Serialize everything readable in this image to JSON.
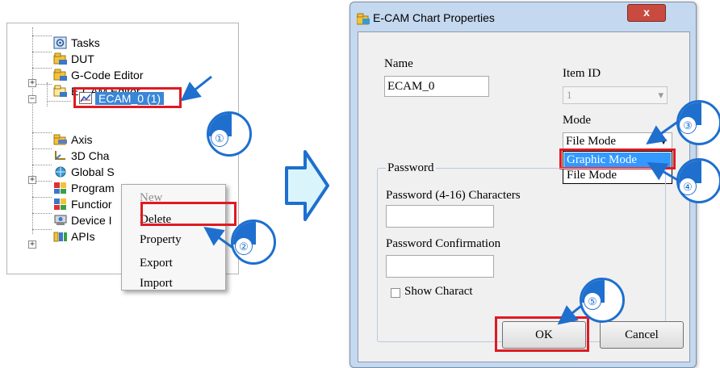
{
  "tree": {
    "items": [
      {
        "label": "Tasks",
        "icon": "tasks-icon"
      },
      {
        "label": "DUT",
        "icon": "dut-icon"
      },
      {
        "label": "G-Code Editor",
        "icon": "gcode-editor-icon"
      },
      {
        "label": "E-CAM Editor",
        "icon": "ecam-editor-icon"
      },
      {
        "label": "ECAM_0 (1)",
        "icon": "ecam-chart-icon",
        "selected": true
      },
      {
        "label": "Axis",
        "icon": "axis-icon"
      },
      {
        "label": "3D Cha",
        "icon": "3d-chart-icon"
      },
      {
        "label": "Global S",
        "icon": "global-variables-icon"
      },
      {
        "label": "Program",
        "icon": "program-icon"
      },
      {
        "label": "Functior",
        "icon": "function-icon"
      },
      {
        "label": "Device I",
        "icon": "device-icon"
      },
      {
        "label": "APIs",
        "icon": "apis-icon"
      }
    ]
  },
  "context_menu": {
    "items": [
      {
        "label": "New",
        "disabled": true
      },
      {
        "label": "Delete"
      },
      {
        "label": "Property"
      },
      {
        "label": "Export"
      },
      {
        "label": "Import"
      }
    ]
  },
  "steps": [
    "①",
    "②",
    "③",
    "④",
    "⑤"
  ],
  "dialog": {
    "title": "E-CAM Chart Properties",
    "close_label": "x",
    "name_label": "Name",
    "name_value": "ECAM_0",
    "item_id_label": "Item ID",
    "item_id_value": "1",
    "mode_label": "Mode",
    "mode_value": "File Mode",
    "mode_options": [
      "Graphic Mode",
      "File Mode"
    ],
    "password_group": "Password",
    "password_label": "Password (4-16) Characters",
    "password_value": "",
    "confirm_label": "Password Confirmation",
    "confirm_value": "",
    "show_chars_label": "Show Charact",
    "ok_label": "OK",
    "cancel_label": "Cancel"
  },
  "colors": {
    "highlight_red": "#e01a22",
    "step_blue": "#1e6fce",
    "selection_blue": "#3399ff",
    "arrow_fill": "#d9f5fb"
  }
}
